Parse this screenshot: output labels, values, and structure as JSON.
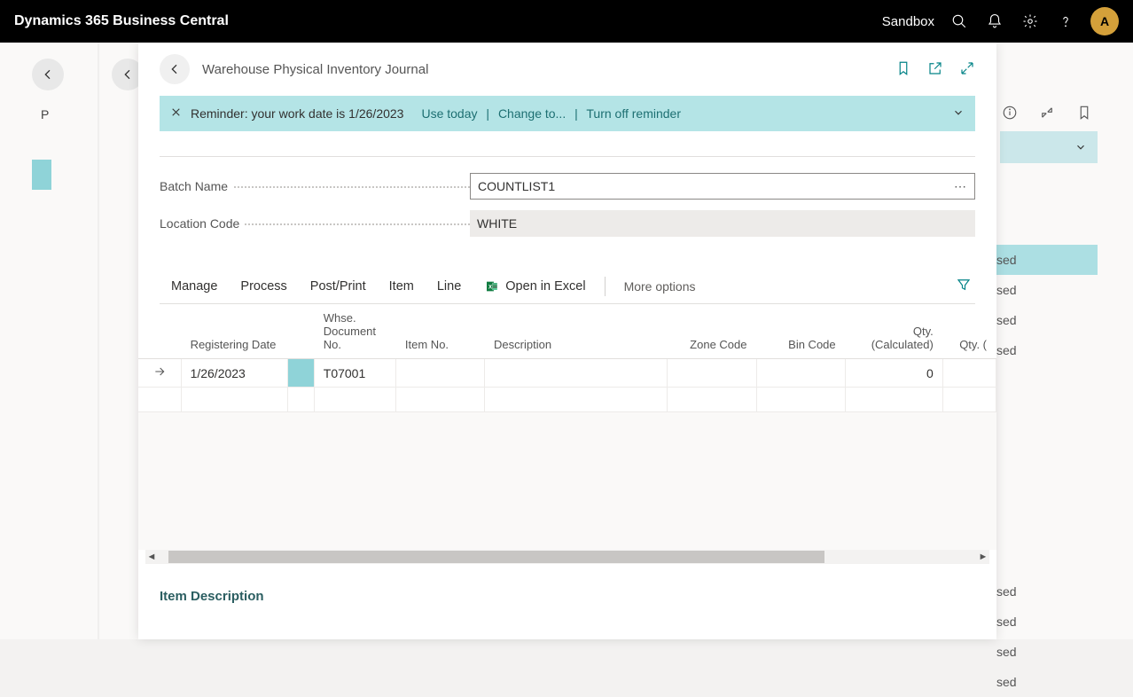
{
  "topbar": {
    "title": "Dynamics 365 Business Central",
    "env": "Sandbox",
    "avatar": "A"
  },
  "panel": {
    "title": "Warehouse Physical Inventory Journal"
  },
  "notif": {
    "msg": "Reminder: your work date is 1/26/2023",
    "use_today": "Use today",
    "change_to": "Change to...",
    "turn_off": "Turn off reminder"
  },
  "form": {
    "batch_label": "Batch Name",
    "batch_value": "COUNTLIST1",
    "loc_label": "Location Code",
    "loc_value": "WHITE"
  },
  "actions": {
    "manage": "Manage",
    "process": "Process",
    "postprint": "Post/Print",
    "item": "Item",
    "line": "Line",
    "excel": "Open in Excel",
    "more": "More options"
  },
  "table": {
    "headers": {
      "reg": "Registering Date",
      "doc": "Whse. Document No.",
      "item": "Item No.",
      "desc": "Description",
      "zone": "Zone Code",
      "bin": "Bin Code",
      "qtycalc": "Qty. (Calculated)",
      "qtyphys": "Qty. (Phys. Inventory)"
    },
    "row1": {
      "reg": "1/26/2023",
      "doc": "T07001",
      "qtycalc": "0"
    }
  },
  "footer": {
    "title": "Item Description"
  },
  "under": {
    "p": "P",
    "sed": "sed"
  }
}
